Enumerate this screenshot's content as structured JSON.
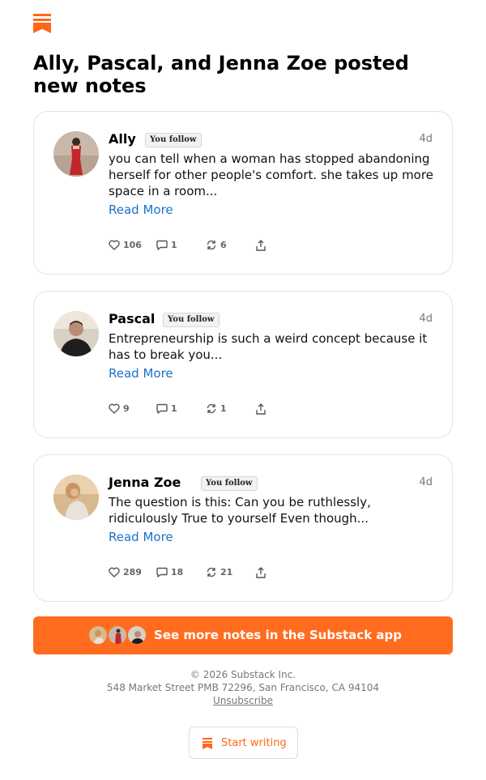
{
  "brand": {
    "accent": "#ff6719",
    "link": "#1a73c8",
    "icon": "substack-bookmark-icon"
  },
  "headline": "Ally, Pascal, and Jenna Zoe posted new notes",
  "notes": [
    {
      "author": "Ally",
      "badge": "You follow",
      "time": "4d",
      "text": "you can tell when a woman has stopped abandoning herself for other people's comfort. she takes up more space in a room...",
      "read_more": "Read More",
      "likes": "106",
      "comments": "1",
      "restacks": "6"
    },
    {
      "author": "Pascal",
      "badge": "You follow",
      "time": "4d",
      "text": "Entrepreneurship is such a weird concept because it has to break you...",
      "read_more": "Read More",
      "likes": "9",
      "comments": "1",
      "restacks": "1"
    },
    {
      "author": "Jenna Zoe",
      "badge": "You follow",
      "time": "4d",
      "text": "The question is this: Can you be ruthlessly, ridiculously True to yourself Even though...",
      "read_more": "Read More",
      "likes": "289",
      "comments": "18",
      "restacks": "21"
    }
  ],
  "cta": {
    "label": "See more notes in the Substack app"
  },
  "footer": {
    "copyright": "© 2026 Substack Inc.",
    "address": "548 Market Street PMB 72296, San Francisco, CA 94104",
    "unsubscribe": "Unsubscribe"
  },
  "start_writing": {
    "label": "Start writing"
  }
}
